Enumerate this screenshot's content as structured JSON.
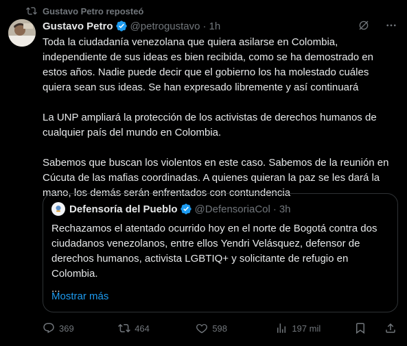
{
  "repost_label": "Gustavo Petro reposteó",
  "tweet": {
    "author_name": "Gustavo Petro",
    "handle": "@petrogustavo",
    "separator": "·",
    "time": "1h",
    "paragraphs": [
      "Toda la ciudadanía venezolana que quiera asilarse en Colombia,\nindependiente de sus ideas es bien recibida, como se ha  demostrado en\nestos años. Nadie puede decir que el gobierno los ha molestado cuáles\nquiera sean sus ideas. Se han expresado libremente y así continuará",
      "La UNP ampliará la protección de los activistas de derechos humanos de\ncualquier país del mundo en Colombia.",
      "Sabemos que buscan los violentos en este caso. Sabemos de la reunión en\nCúcuta de las mafias coordinadas. A quienes quieran la paz se les dará la\nmano, los demás serán enfrentados con contundencia"
    ]
  },
  "quote": {
    "author_name": "Defensoría del Pueblo",
    "handle": "@DefensoriaCol",
    "separator": "·",
    "time": "3h",
    "text": "Rechazamos el atentado ocurrido hoy en el norte de Bogotá contra dos ciudadanos venezolanos, entre ellos Yendri Velásquez, defensor de derechos humanos, activista LGBTIQ+ y solicitante de refugio en Colombia.",
    "ellipsis": "...",
    "show_more": "Mostrar más"
  },
  "actions": {
    "replies": "369",
    "reposts": "464",
    "likes": "598",
    "views": "197 mil"
  },
  "colors": {
    "background": "#000000",
    "text": "#e7e9ea",
    "muted": "#71767b",
    "link": "#1d9bf0",
    "verified": "#1d9bf0",
    "border": "#2f3336"
  },
  "icons": [
    "repost-icon",
    "verified-badge-icon",
    "grok-icon",
    "more-icon",
    "reply-icon",
    "like-icon",
    "views-icon",
    "bookmark-icon",
    "share-icon"
  ]
}
